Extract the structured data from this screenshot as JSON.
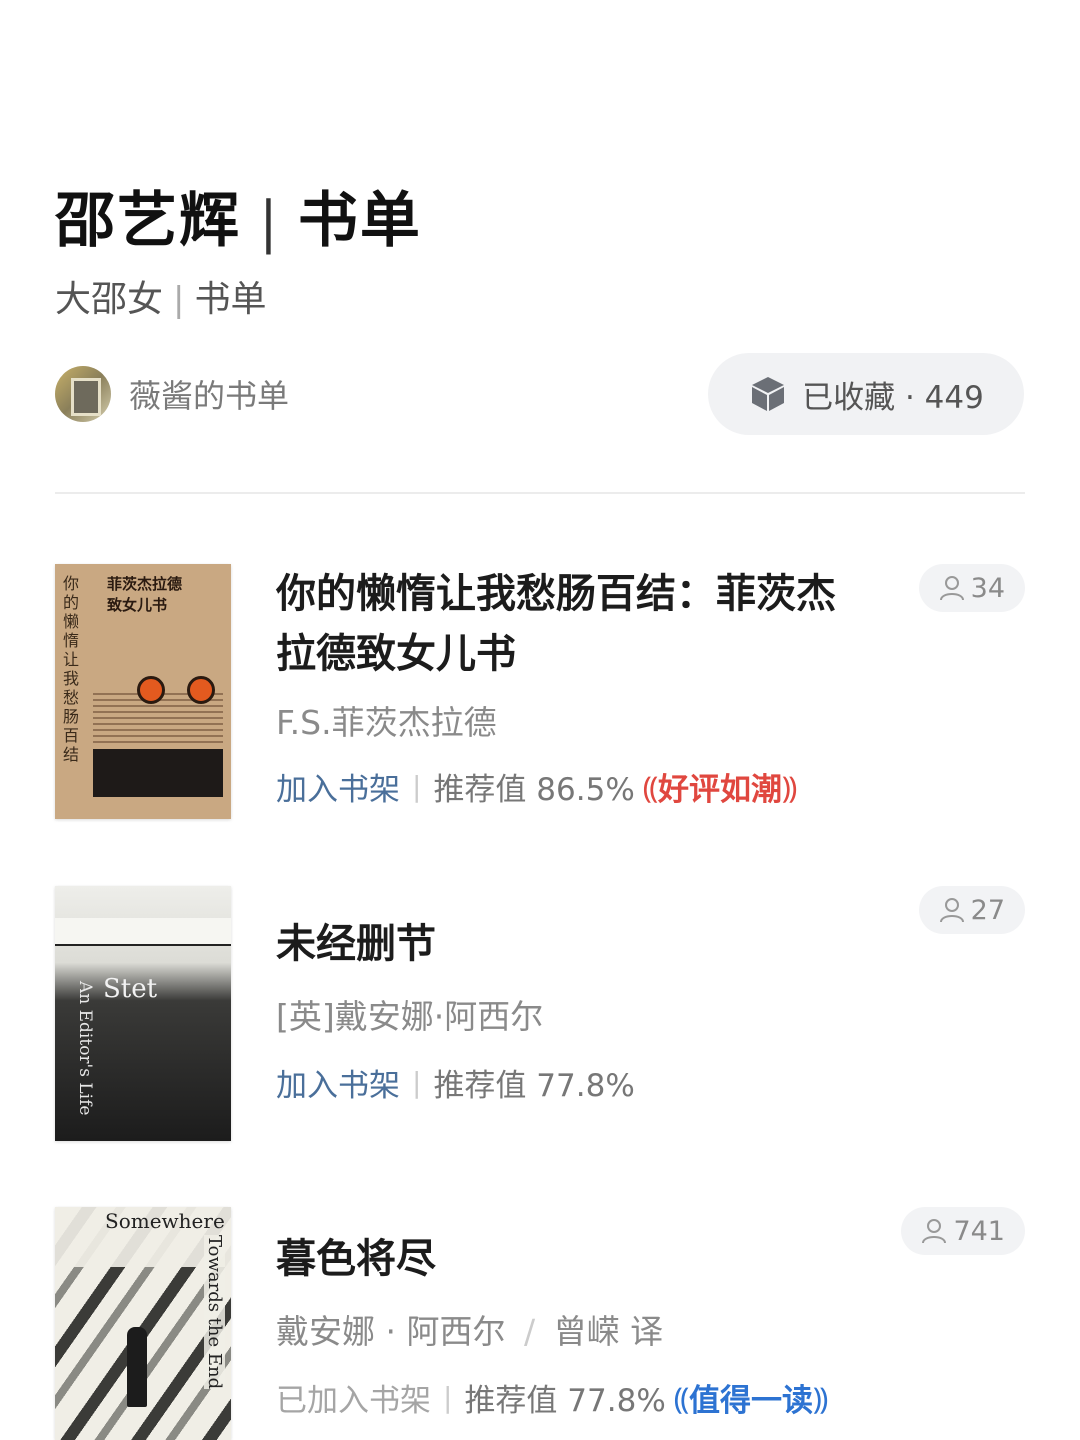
{
  "header": {
    "title_main": "邵艺辉",
    "title_sep": "|",
    "title_suffix": "书单",
    "subtitle_main": "大邵女",
    "subtitle_sep": "|",
    "subtitle_suffix": "书单"
  },
  "curator": {
    "name": "薇酱的书单"
  },
  "collect": {
    "label": "已收藏 · 449"
  },
  "books": [
    {
      "title": "你的懒惰让我愁肠百结：菲茨杰拉德致女儿书",
      "author": "F.S.菲茨杰拉德",
      "shelf_label": "加入书架",
      "rating": "推荐值 86.5%",
      "badge": "好评如潮",
      "readers": "34",
      "cover_vertical": "你的懒惰让我愁肠百结",
      "cover_title_1": "菲茨杰拉德",
      "cover_title_2": "致女儿书"
    },
    {
      "title": "未经删节",
      "author": "[英]戴安娜·阿西尔",
      "shelf_label": "加入书架",
      "rating": "推荐值 77.8%",
      "badge": "",
      "readers": "27",
      "cover_title": "Stet",
      "cover_sub": "An Editor's Life"
    },
    {
      "title": "暮色将尽",
      "author_1": "戴安娜 · 阿西尔",
      "author_sep": "/",
      "author_2": "曾嵘 译",
      "shelf_label": "已加入书架",
      "rating": "推荐值 77.8%",
      "badge": "值得一读",
      "readers": "741",
      "cover_title_1": "Somewhere",
      "cover_title_2": "Towards the End"
    }
  ],
  "colors": {
    "link_blue": "#4a6f9a",
    "badge_red": "#e0473f",
    "badge_blue": "#2d73d2"
  },
  "icons": {
    "collect": "cube-icon",
    "readers": "person-icon",
    "laurel": "laurel-icon"
  }
}
